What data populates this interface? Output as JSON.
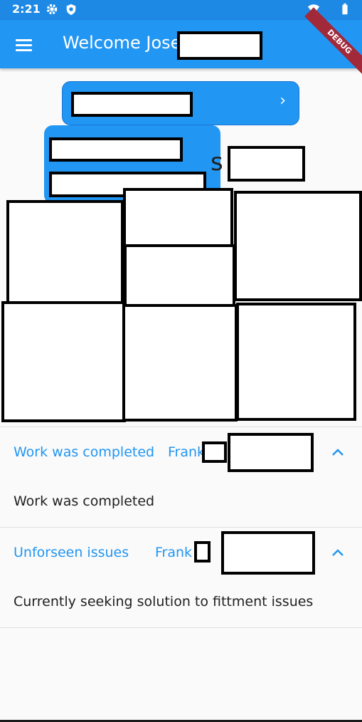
{
  "status_bar": {
    "time": "2:21",
    "icons": [
      "gear-icon",
      "shield-icon",
      "wifi-icon",
      "battery-icon"
    ]
  },
  "app_bar": {
    "title": "Welcome Jose",
    "menu_icon": "hamburger-icon",
    "background": "#2196f3",
    "debug_label": "DEBUG"
  },
  "partial_glyph": "s",
  "notes": [
    {
      "title": "Work was completed",
      "author": "Frank",
      "body": "Work was completed",
      "expanded": true
    },
    {
      "title": "Unforseen issues",
      "author": "Frank",
      "body": "Currently seeking solution to fittment issues",
      "expanded": true
    }
  ],
  "colors": {
    "primary": "#2196f3",
    "status_bar": "#1e88e5",
    "accent_text": "#2196f3",
    "debug_ribbon": "#a1293a"
  }
}
